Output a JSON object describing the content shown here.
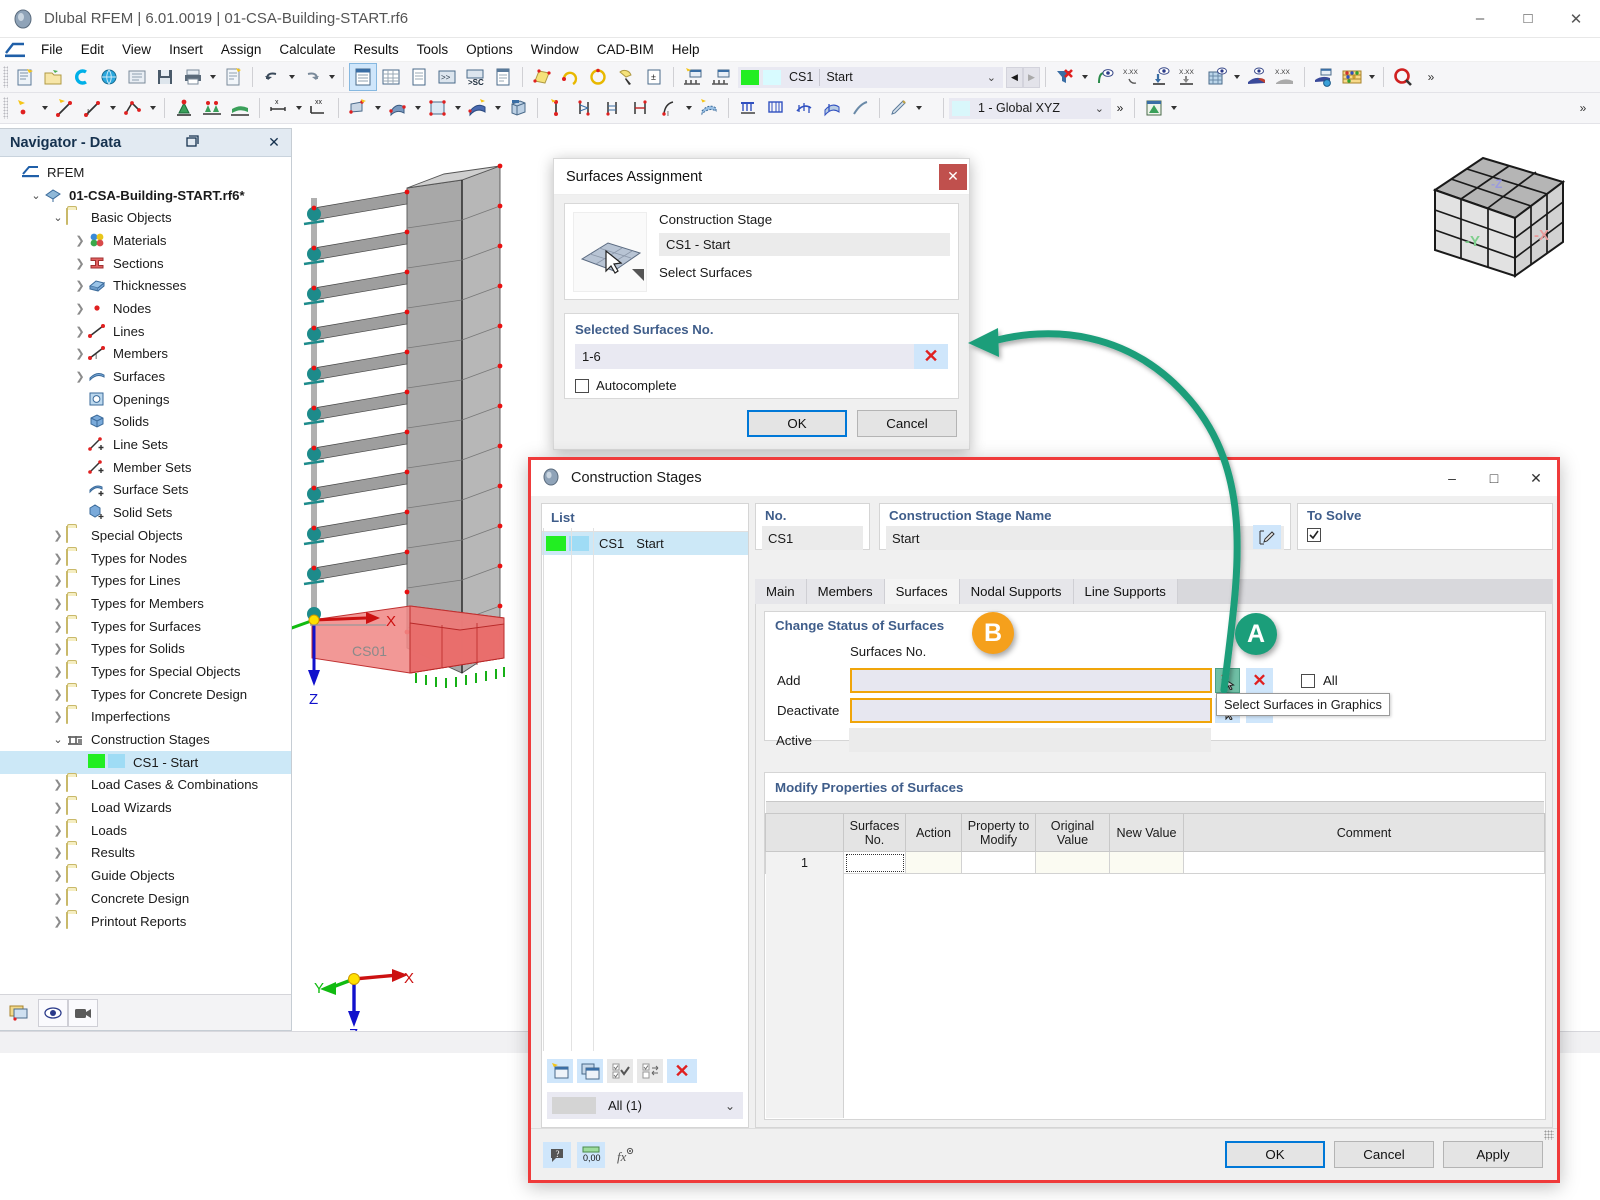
{
  "app": {
    "title": "Dlubal RFEM | 6.01.0019 | 01-CSA-Building-START.rf6",
    "icon": "dlubal-logo-icon",
    "window_controls": {
      "minimize": "–",
      "maximize": "□",
      "close": "✕"
    }
  },
  "menubar": {
    "items": [
      "File",
      "Edit",
      "View",
      "Insert",
      "Assign",
      "Calculate",
      "Results",
      "Tools",
      "Options",
      "Window",
      "CAD-BIM",
      "Help"
    ]
  },
  "toolbar1": {
    "icons": [
      "new-model-icon",
      "open-folder-icon",
      "rfem-c-icon",
      "globe-icon",
      "properties-icon",
      "save-icon",
      "print-icon",
      "report-icon",
      "undo-icon",
      "redo-icon",
      "table-panel-icon",
      "table-grid-icon",
      "table-list-icon",
      "console-icon",
      "script-sc-icon",
      "table-detail-icon",
      "select-surface-icon",
      "rotate-node-icon",
      "rotate-circle-icon",
      "select-cursor-icon",
      "dimension-icon",
      "stage-new-icon",
      "stage-copy-icon"
    ],
    "stage_combo": {
      "color_swatch": "#22ee22",
      "color_swatch2": "#d8fbff",
      "number": "CS1",
      "name": "Start",
      "chevron": "⌄"
    },
    "nav_prev": "◀",
    "nav_next": "▶",
    "right_icons": [
      "filter-x-icon",
      "visibility-bend-icon",
      "xxx-select-icon",
      "load-down-icon",
      "xxx-load-icon",
      "grid-visibility-icon",
      "surface-view-icon",
      "xxx-gradient-icon",
      "render-config-icon",
      "abacus-icon",
      "target-search-icon"
    ]
  },
  "toolbar2": {
    "icons": [
      "node-new-icon",
      "line-new-icon",
      "member-new-icon",
      "polyline-icon",
      "support-new-icon",
      "nodal-support-icon",
      "surface-support-icon",
      "dim-x-icon",
      "dim-xx-icon",
      "surface-new-icon",
      "solid-new-icon",
      "opening-new-icon",
      "thickness-icon",
      "solid-block-icon",
      "node-single-icon",
      "line-hinge-icon",
      "member-hinge-icon",
      "release-icon",
      "imperfection-icon",
      "mesh-icon",
      "load-line-icon",
      "load-free-icon",
      "load-area-icon",
      "load-surface-icon",
      "load-temp-icon",
      "pen-edit-icon"
    ],
    "cs_combo": {
      "swatch": "#d9f7fb",
      "label": "1 - Global XYZ",
      "chevron": "⌄",
      "overflow": "»"
    },
    "right_icons": [
      "render-green-icon"
    ]
  },
  "navigator": {
    "title": "Navigator - Data",
    "dock_icon": "dock-icon",
    "close_icon": "close-icon",
    "tree": [
      {
        "label": "RFEM",
        "indent": 0,
        "toggle": "none",
        "icon": "rfem-icon"
      },
      {
        "label": "01-CSA-Building-START.rf6*",
        "indent": 1,
        "toggle": "expanded",
        "icon": "model-icon",
        "bold": true
      },
      {
        "label": "Basic Objects",
        "indent": 2,
        "toggle": "expanded",
        "icon": "folder-icon"
      },
      {
        "label": "Materials",
        "indent": 3,
        "toggle": "collapsed",
        "icon": "materials-icon"
      },
      {
        "label": "Sections",
        "indent": 3,
        "toggle": "collapsed",
        "icon": "sections-icon"
      },
      {
        "label": "Thicknesses",
        "indent": 3,
        "toggle": "collapsed",
        "icon": "thicknesses-icon"
      },
      {
        "label": "Nodes",
        "indent": 3,
        "toggle": "collapsed",
        "icon": "nodes-icon"
      },
      {
        "label": "Lines",
        "indent": 3,
        "toggle": "collapsed",
        "icon": "lines-icon"
      },
      {
        "label": "Members",
        "indent": 3,
        "toggle": "collapsed",
        "icon": "members-icon"
      },
      {
        "label": "Surfaces",
        "indent": 3,
        "toggle": "collapsed",
        "icon": "surfaces-icon"
      },
      {
        "label": "Openings",
        "indent": 3,
        "toggle": "none",
        "icon": "openings-icon"
      },
      {
        "label": "Solids",
        "indent": 3,
        "toggle": "none",
        "icon": "solids-icon"
      },
      {
        "label": "Line Sets",
        "indent": 3,
        "toggle": "none",
        "icon": "line-sets-icon"
      },
      {
        "label": "Member Sets",
        "indent": 3,
        "toggle": "none",
        "icon": "member-sets-icon"
      },
      {
        "label": "Surface Sets",
        "indent": 3,
        "toggle": "none",
        "icon": "surface-sets-icon"
      },
      {
        "label": "Solid Sets",
        "indent": 3,
        "toggle": "none",
        "icon": "solid-sets-icon"
      },
      {
        "label": "Special Objects",
        "indent": 2,
        "toggle": "collapsed",
        "icon": "folder-icon"
      },
      {
        "label": "Types for Nodes",
        "indent": 2,
        "toggle": "collapsed",
        "icon": "folder-icon"
      },
      {
        "label": "Types for Lines",
        "indent": 2,
        "toggle": "collapsed",
        "icon": "folder-icon"
      },
      {
        "label": "Types for Members",
        "indent": 2,
        "toggle": "collapsed",
        "icon": "folder-icon"
      },
      {
        "label": "Types for Surfaces",
        "indent": 2,
        "toggle": "collapsed",
        "icon": "folder-icon"
      },
      {
        "label": "Types for Solids",
        "indent": 2,
        "toggle": "collapsed",
        "icon": "folder-icon"
      },
      {
        "label": "Types for Special Objects",
        "indent": 2,
        "toggle": "collapsed",
        "icon": "folder-icon"
      },
      {
        "label": "Types for Concrete Design",
        "indent": 2,
        "toggle": "collapsed",
        "icon": "folder-icon"
      },
      {
        "label": "Imperfections",
        "indent": 2,
        "toggle": "collapsed",
        "icon": "folder-icon"
      },
      {
        "label": "Construction Stages",
        "indent": 2,
        "toggle": "expanded",
        "icon": "construction-stages-icon"
      },
      {
        "label": "CS1 - Start",
        "indent": 3,
        "toggle": "none",
        "icon": "stage-swatch-icon",
        "selected": true
      },
      {
        "label": "Load Cases & Combinations",
        "indent": 2,
        "toggle": "collapsed",
        "icon": "folder-icon"
      },
      {
        "label": "Load Wizards",
        "indent": 2,
        "toggle": "collapsed",
        "icon": "folder-icon"
      },
      {
        "label": "Loads",
        "indent": 2,
        "toggle": "collapsed",
        "icon": "folder-icon"
      },
      {
        "label": "Results",
        "indent": 2,
        "toggle": "collapsed",
        "icon": "folder-icon"
      },
      {
        "label": "Guide Objects",
        "indent": 2,
        "toggle": "collapsed",
        "icon": "folder-icon"
      },
      {
        "label": "Concrete Design",
        "indent": 2,
        "toggle": "collapsed",
        "icon": "folder-icon"
      },
      {
        "label": "Printout Reports",
        "indent": 2,
        "toggle": "collapsed",
        "icon": "folder-icon"
      }
    ],
    "footer_icons": [
      "render-view-icon",
      "eye-icon",
      "camera-icon"
    ]
  },
  "view3d": {
    "stage_label": "CS01",
    "axes": {
      "x": "X",
      "y": "Y",
      "z": "Z"
    },
    "origin_axes": {
      "x": "X",
      "y": "Y",
      "z": "Z"
    },
    "nav_cube": {
      "face_y": "-Y",
      "face_x": "-X",
      "face_z": "-Z"
    }
  },
  "surfaces_assignment": {
    "title": "Surfaces Assignment",
    "close": "✕",
    "preview_icon": "surface-select-preview-icon",
    "stage_label": "Construction Stage",
    "stage_value": "CS1 - Start",
    "select_hint": "Select Surfaces",
    "selected_group": "Selected Surfaces No.",
    "selected_value": "1-6",
    "clear_icon": "✕",
    "autocomplete_label": "Autocomplete",
    "autocomplete_checked": false,
    "ok": "OK",
    "cancel": "Cancel"
  },
  "construction_stages": {
    "title": "Construction Stages",
    "icon": "construction-stages-dialog-icon",
    "window_controls": {
      "minimize": "–",
      "maximize": "□",
      "close": "✕"
    },
    "list": {
      "header": "List",
      "rows": [
        {
          "swatch1": "#22ee22",
          "swatch2": "#9fdcf5",
          "no": "CS1",
          "name": "Start",
          "selected": true
        }
      ],
      "toolbar_icons": [
        "new-stage-icon",
        "copy-stage-icon",
        "check-all-icon",
        "invert-check-icon",
        "delete-stage-icon"
      ],
      "filter_value": "All (1)",
      "filter_chevron": "⌄"
    },
    "no_label": "No.",
    "no_value": "CS1",
    "name_label": "Construction Stage Name",
    "name_value": "Start",
    "name_edit_icon": "edit-pencil-icon",
    "to_solve_label": "To Solve",
    "to_solve_checked": true,
    "tabs": [
      {
        "label": "Main",
        "active": false
      },
      {
        "label": "Members",
        "active": false
      },
      {
        "label": "Surfaces",
        "active": true
      },
      {
        "label": "Nodal Supports",
        "active": false
      },
      {
        "label": "Line Supports",
        "active": false
      }
    ],
    "change_status": {
      "group_title": "Change Status of Surfaces",
      "column_label": "Surfaces No.",
      "rows": [
        {
          "label": "Add",
          "value": "",
          "highlighted": true
        },
        {
          "label": "Deactivate",
          "value": "",
          "highlighted": true
        }
      ],
      "active_label": "Active",
      "active_value": "",
      "select_graphics_icon": "select-surfaces-graphics-icon",
      "clear_icon": "✕",
      "all_label": "All",
      "all_checked": false
    },
    "modify_properties": {
      "group_title": "Modify Properties of Surfaces",
      "columns": [
        "",
        "Surfaces No.",
        "Action",
        "Property to Modify",
        "Original Value",
        "New Value",
        "Comment"
      ],
      "rows": [
        {
          "idx": "1",
          "surfaces_no": "",
          "action": "",
          "property": "",
          "original": "",
          "new": "",
          "comment": ""
        }
      ]
    },
    "footer_icons": [
      "info-icon",
      "units-0-00-icon",
      "formula-icon"
    ],
    "buttons": {
      "ok": "OK",
      "cancel": "Cancel",
      "apply": "Apply"
    }
  },
  "annotations": {
    "badge_a": {
      "letter": "A",
      "color": "#1b9e7a"
    },
    "badge_b": {
      "letter": "B",
      "color": "#f5a01c"
    },
    "tooltip": "Select Surfaces in Graphics"
  },
  "colors": {
    "accent_blue": "#0078d7",
    "group_header": "#3f5d8a",
    "highlight_orange": "#f0a50a",
    "callout_green": "#1b9e7a",
    "dialog_border_red": "#ef3b3b",
    "selection_blue": "#cce8f7"
  }
}
